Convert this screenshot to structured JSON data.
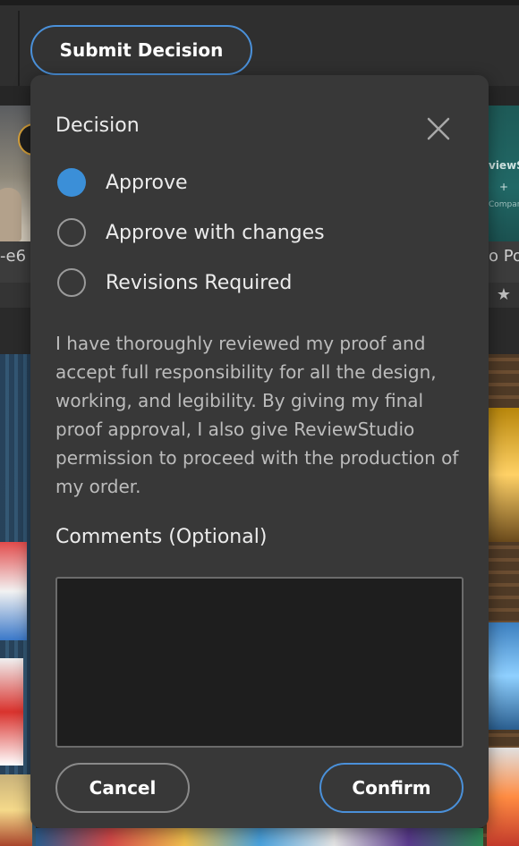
{
  "toolbar": {
    "submit_label": "Submit Decision"
  },
  "background": {
    "left_caption": "-e6",
    "right_title": "viewS",
    "right_plus": "+",
    "right_small": "Compar",
    "right_caption": "o Po"
  },
  "modal": {
    "title": "Decision",
    "options": [
      {
        "label": "Approve",
        "selected": true
      },
      {
        "label": "Approve with changes",
        "selected": false
      },
      {
        "label": "Revisions Required",
        "selected": false
      }
    ],
    "terms": "I have thoroughly reviewed my proof and accept full responsibility for all the design, working, and legibility. By giving my final proof approval, I also give ReviewStudio permission to proceed with the production of my order.",
    "comments_label": "Comments (Optional)",
    "comments_value": "",
    "cancel_label": "Cancel",
    "confirm_label": "Confirm"
  },
  "colors": {
    "accent": "#3b8fd8",
    "modal_bg": "#383838",
    "page_bg": "#2b2b2b"
  },
  "icons": {
    "close": "close-icon",
    "star": "star-icon"
  }
}
